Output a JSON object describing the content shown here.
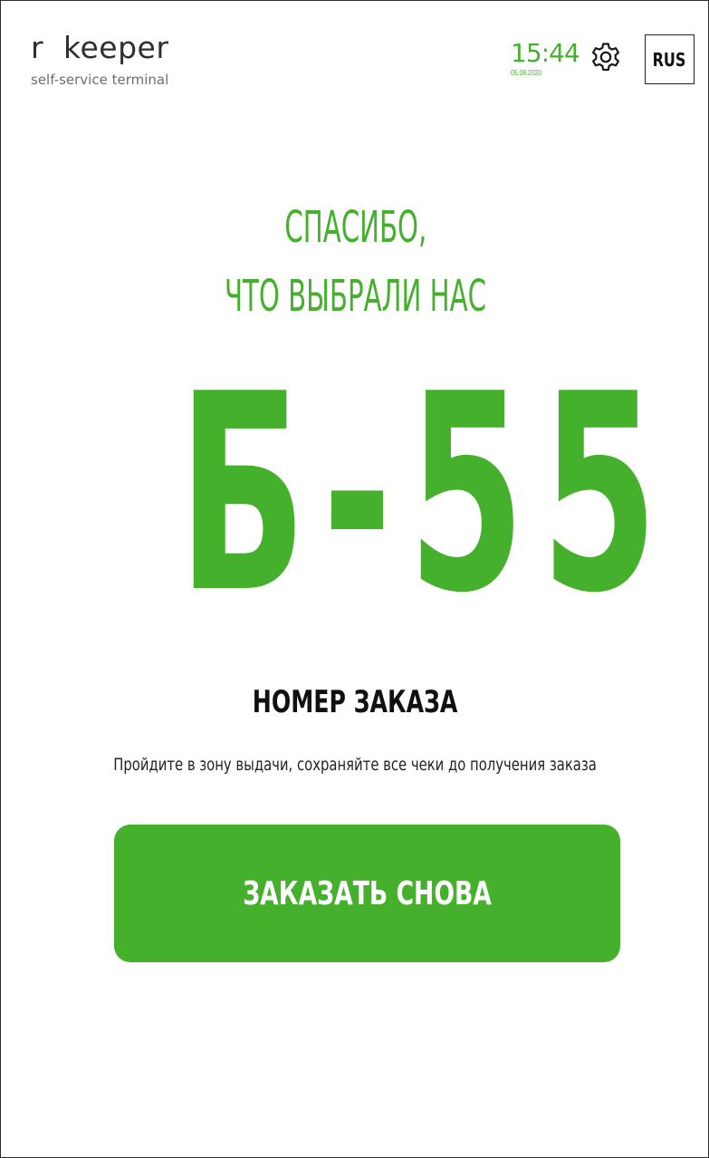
{
  "header": {
    "logo_main": "r  keeper",
    "logo_sub": "self-service terminal",
    "time": "15:44",
    "date": "05.08.2020",
    "settings_icon": "gear-icon",
    "language": "RUS"
  },
  "main": {
    "thanks_line1": "СПАСИБО,",
    "thanks_line2": "ЧТО ВЫБРАЛИ НАС",
    "order_number": "Б-55",
    "order_label": "НОМЕР ЗАКАЗА",
    "hint": "Пройдите в зону выдачи, сохраняйте все чеки до получения заказа",
    "order_again_label": "ЗАКАЗАТЬ СНОВА"
  },
  "colors": {
    "accent": "#44b02c",
    "text": "#111111",
    "background": "#ffffff"
  }
}
